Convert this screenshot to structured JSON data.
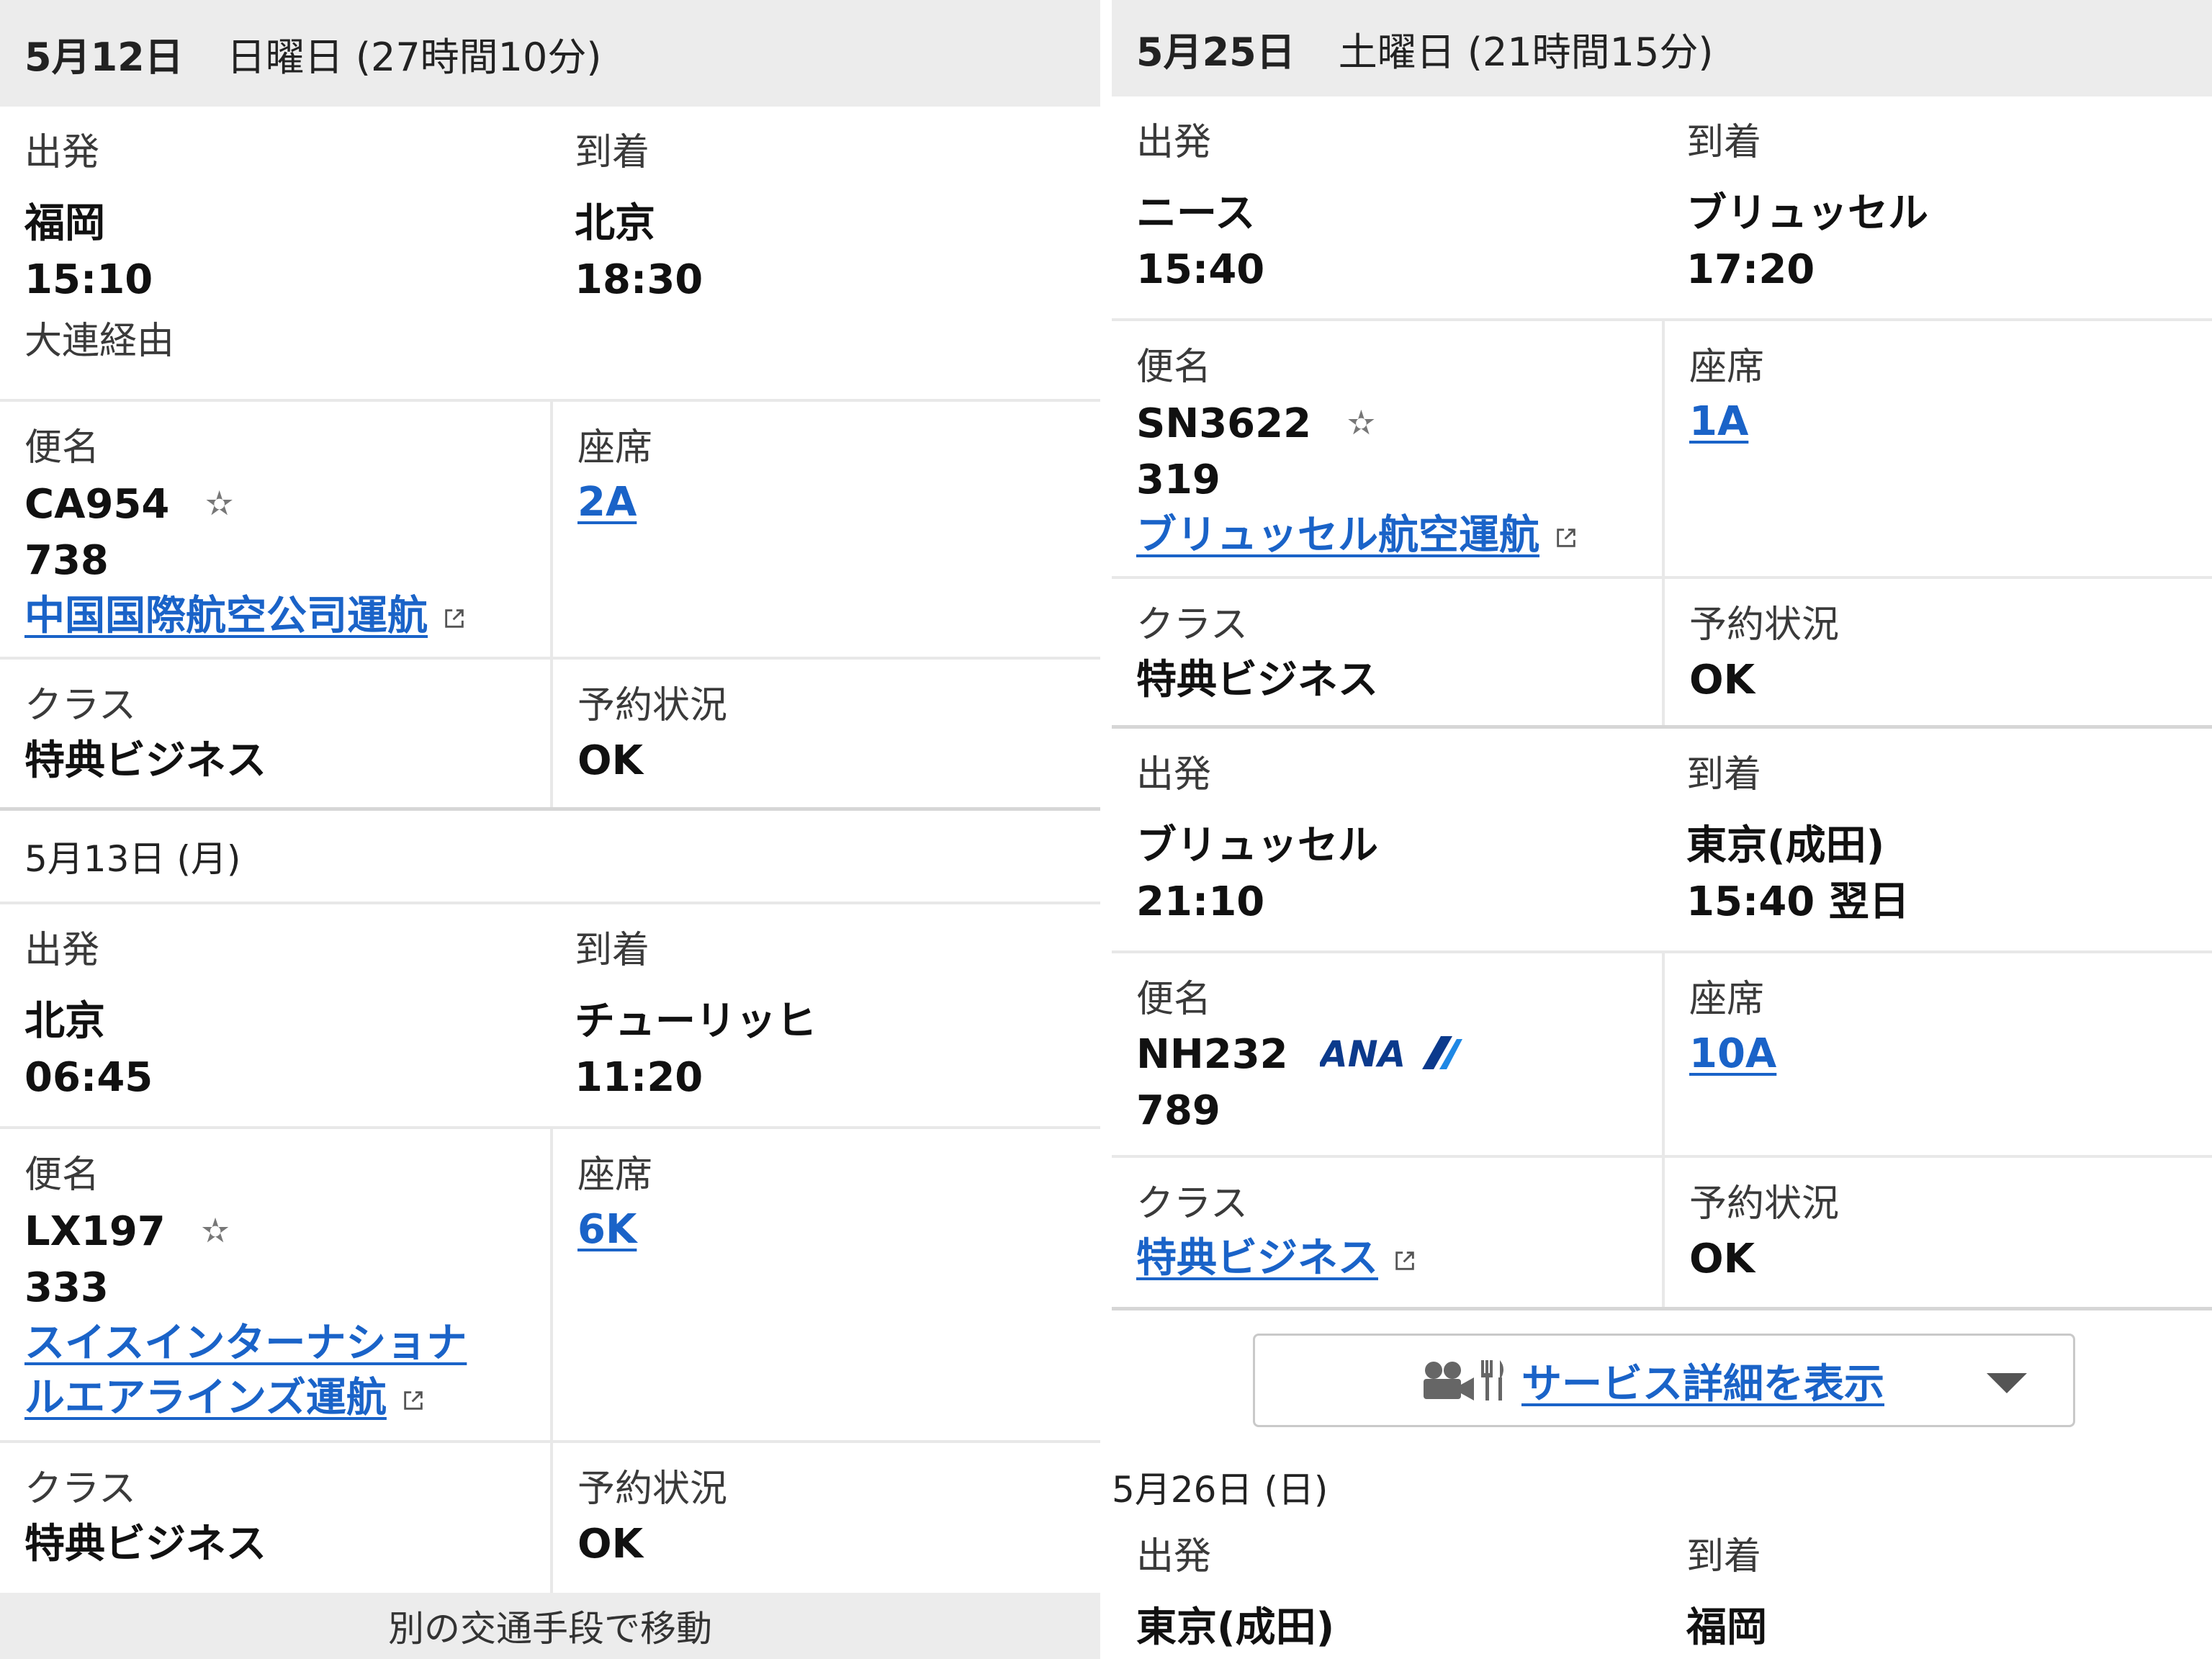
{
  "left": {
    "day1": {
      "date": "5月12日",
      "info": "日曜日 (27時間10分)"
    },
    "seg1": {
      "depart_label": "出発",
      "arrive_label": "到着",
      "from": "福岡",
      "dep_time": "15:10",
      "to": "北京",
      "arr_time": "18:30",
      "via": "大連経由",
      "flight_label": "便名",
      "flight": "CA954",
      "aircraft": "738",
      "operator": "中国国際航空公司運航",
      "seat_label": "座席",
      "seat": "2A",
      "class_label": "クラス",
      "class": "特典ビジネス",
      "status_label": "予約状況",
      "status": "OK"
    },
    "day2": {
      "date": "5月13日 (月)"
    },
    "seg2": {
      "depart_label": "出発",
      "arrive_label": "到着",
      "from": "北京",
      "dep_time": "06:45",
      "to": "チューリッヒ",
      "arr_time": "11:20",
      "flight_label": "便名",
      "flight": "LX197",
      "aircraft": "333",
      "operator_line1": "スイスインターナショナ",
      "operator_line2": "ルエアラインズ運航",
      "seat_label": "座席",
      "seat": "6K",
      "class_label": "クラス",
      "class": "特典ビジネス",
      "status_label": "予約状況",
      "status": "OK"
    },
    "footer": "別の交通手段で移動"
  },
  "right": {
    "day1": {
      "date": "5月25日",
      "info": "土曜日 (21時間15分)"
    },
    "seg1": {
      "depart_label": "出発",
      "arrive_label": "到着",
      "from": "ニース",
      "dep_time": "15:40",
      "to": "ブリュッセル",
      "arr_time": "17:20",
      "flight_label": "便名",
      "flight": "SN3622",
      "aircraft": "319",
      "operator": "ブリュッセル航空運航",
      "seat_label": "座席",
      "seat": "1A",
      "class_label": "クラス",
      "class": "特典ビジネス",
      "status_label": "予約状況",
      "status": "OK"
    },
    "seg2": {
      "depart_label": "出発",
      "arrive_label": "到着",
      "from": "ブリュッセル",
      "dep_time": "21:10",
      "to": "東京(成田)",
      "arr_time": "15:40 翌日",
      "flight_label": "便名",
      "flight": "NH232",
      "airline_logo": "ANA",
      "aircraft": "789",
      "seat_label": "座席",
      "seat": "10A",
      "class_label": "クラス",
      "class": "特典ビジネス",
      "status_label": "予約状況",
      "status": "OK"
    },
    "service_button": "サービス詳細を表示",
    "day2": {
      "date": "5月26日 (日)"
    },
    "seg3": {
      "depart_label": "出発",
      "arrive_label": "到着",
      "from": "東京(成田)",
      "to": "福岡"
    }
  },
  "colors": {
    "link": "#1a63c8",
    "band": "#ececec",
    "divider": "#e8e8e8",
    "text": "#222222"
  },
  "icons": [
    "star-alliance-icon",
    "external-link-icon",
    "movie-camera-icon",
    "fork-knife-icon",
    "chevron-down-icon"
  ]
}
